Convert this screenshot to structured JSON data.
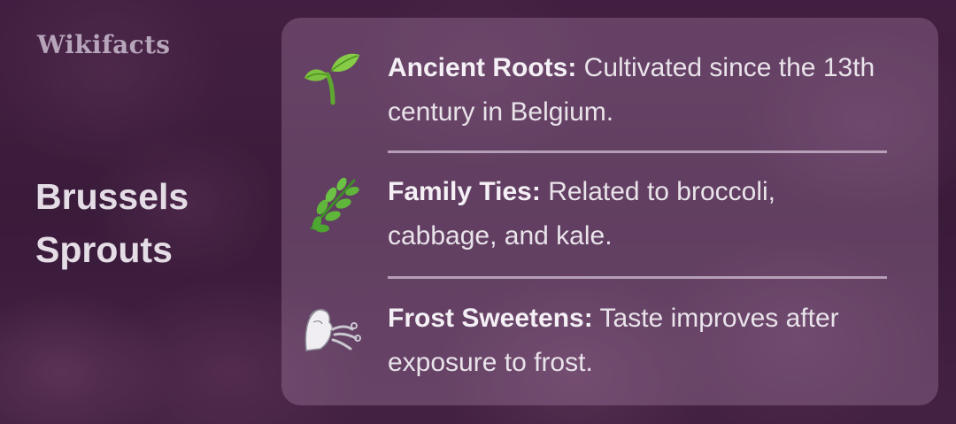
{
  "brand": "Wikifacts",
  "title_line1": "Brussels",
  "title_line2": "Sprouts",
  "facts": [
    {
      "icon": "seedling-icon",
      "label": "Ancient Roots:",
      "text": "Cultivated since the 13th century in Belgium."
    },
    {
      "icon": "herb-icon",
      "label": "Family Ties:",
      "text": "Related to broccoli, cabbage, and kale."
    },
    {
      "icon": "wind-face-icon",
      "label": "Frost Sweetens:",
      "text": "Taste improves after exposure to frost."
    }
  ],
  "colors": {
    "card": "#b996b9",
    "text": "#e9e3ea",
    "background": "#3c1f3b"
  }
}
